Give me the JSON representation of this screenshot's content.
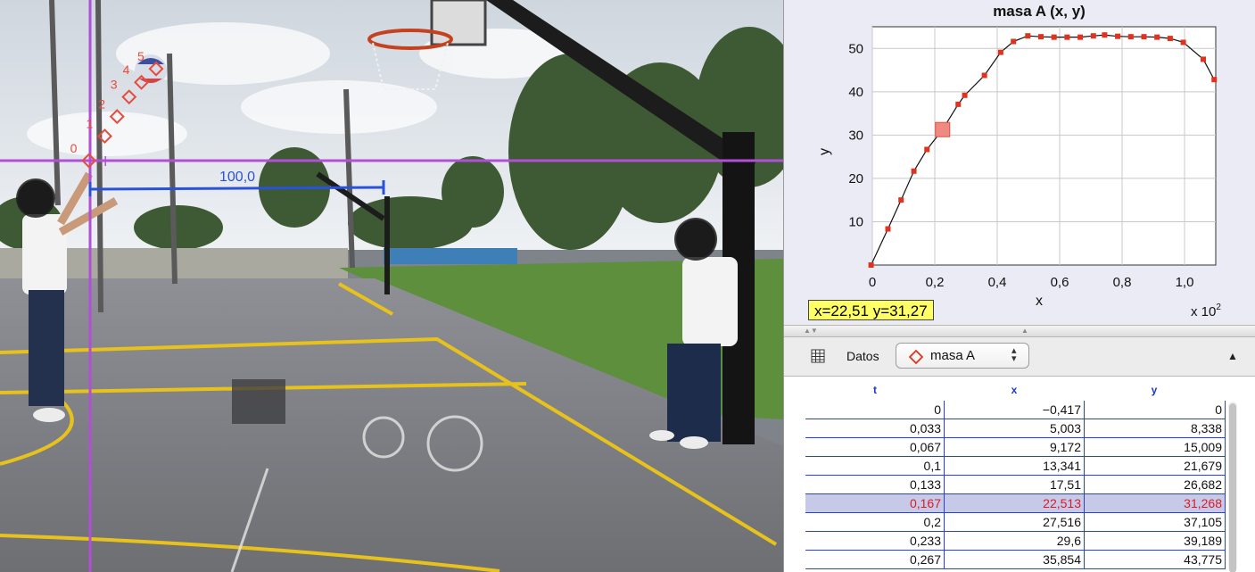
{
  "video": {
    "scale_label": "100,0",
    "axis_label": "I",
    "track_labels": [
      "0",
      "1",
      "2",
      "3",
      "4",
      "5"
    ],
    "track_color": "#e64b3c",
    "axis_color": "#b14fd8",
    "calibration_color": "#2a52d8"
  },
  "plot": {
    "title": "masa A (x, y)",
    "readout": "x=22,51  y=31,27",
    "exponent_text": "x 10",
    "exponent_power": "2"
  },
  "chart_data": {
    "type": "line",
    "title": "masa A (x, y)",
    "xlabel": "x",
    "ylabel": "y",
    "x_multiplier": "x 10^2",
    "xlim": [
      0,
      1.1
    ],
    "ylim": [
      0,
      55
    ],
    "x_ticks": [
      "0",
      "0,2",
      "0,4",
      "0,6",
      "0,8",
      "1,0"
    ],
    "y_ticks": [
      "10",
      "20",
      "30",
      "40",
      "50"
    ],
    "grid": true,
    "series": [
      {
        "x": [
          -0.004,
          0.05,
          0.092,
          0.133,
          0.175,
          0.225,
          0.275,
          0.296,
          0.359,
          0.411,
          0.452,
          0.498,
          0.54,
          0.582,
          0.624,
          0.666,
          0.708,
          0.744,
          0.786,
          0.828,
          0.87,
          0.912,
          0.954,
          0.996,
          1.06,
          1.095
        ],
        "y": [
          0,
          8.338,
          15.009,
          21.679,
          26.682,
          31.268,
          37.105,
          39.189,
          43.775,
          49.1,
          51.6,
          52.9,
          52.7,
          52.6,
          52.6,
          52.6,
          52.9,
          53.1,
          52.8,
          52.7,
          52.7,
          52.6,
          52.3,
          51.4,
          47.5,
          42.8
        ],
        "selected_index": 5,
        "color": "#e0331f"
      }
    ]
  },
  "toolbar": {
    "datos_label": "Datos",
    "track_name": "masa A",
    "stepper": "▴▾",
    "collapse": "▲"
  },
  "table": {
    "headers": [
      "t",
      "x",
      "y"
    ],
    "header_color": "#1a39d4",
    "selected_row": 5,
    "rows": [
      [
        "0",
        "−0,417",
        "0"
      ],
      [
        "0,033",
        "5,003",
        "8,338"
      ],
      [
        "0,067",
        "9,172",
        "15,009"
      ],
      [
        "0,1",
        "13,341",
        "21,679"
      ],
      [
        "0,133",
        "17,51",
        "26,682"
      ],
      [
        "0,167",
        "22,513",
        "31,268"
      ],
      [
        "0,2",
        "27,516",
        "37,105"
      ],
      [
        "0,233",
        "29,6",
        "39,189"
      ],
      [
        "0,267",
        "35,854",
        "43,775"
      ]
    ]
  }
}
